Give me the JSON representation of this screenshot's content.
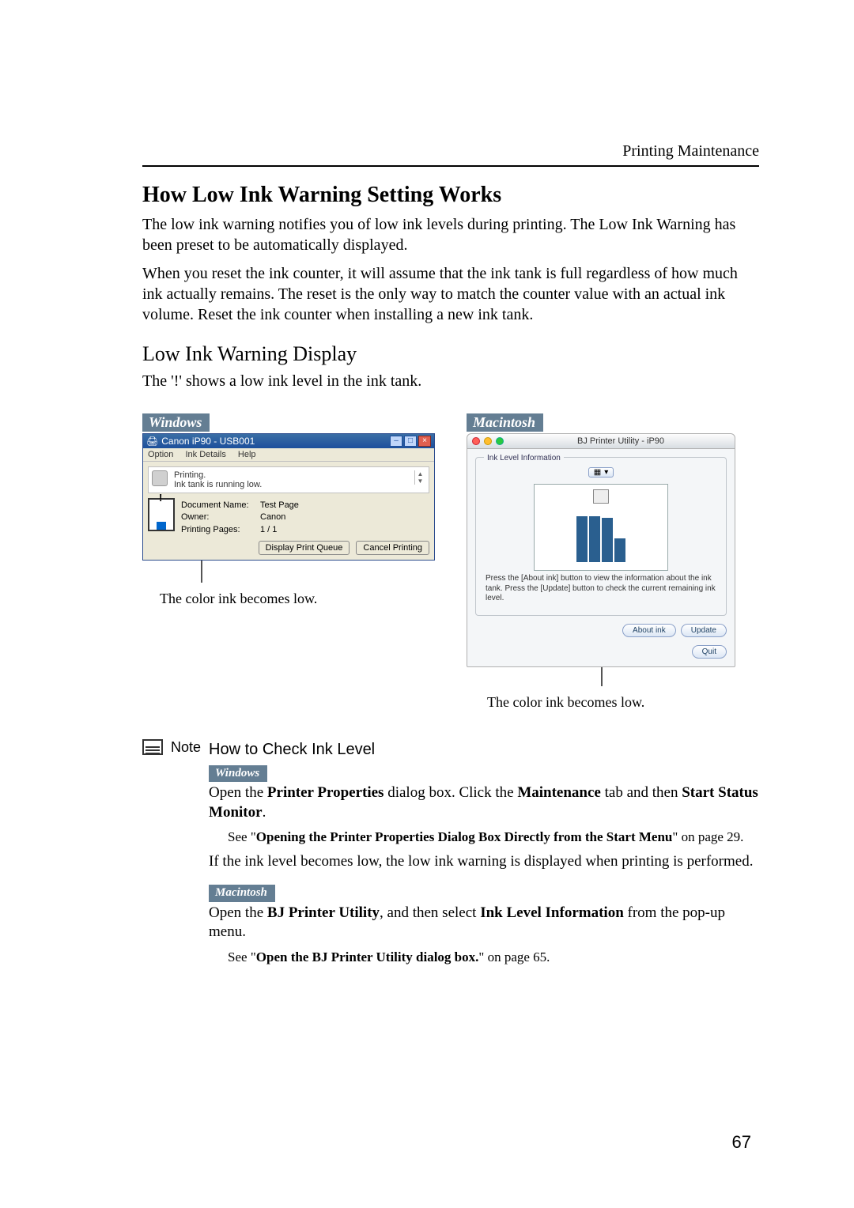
{
  "header": {
    "section_label": "Printing Maintenance"
  },
  "section": {
    "h1": "How Low Ink Warning Setting Works",
    "p1": "The low ink warning notifies you of low ink levels during printing. The Low Ink Warning has been preset to be automatically displayed.",
    "p2": "When you reset the ink counter, it will assume that the ink tank is full regardless of how much ink actually remains. The reset is the only way to match the counter value with an actual ink volume. Reset the ink counter when installing a new ink tank.",
    "h2": "Low Ink Warning Display",
    "p3": "The '!' shows a low ink level in the ink tank."
  },
  "os_labels": {
    "windows": "Windows",
    "macintosh": "Macintosh"
  },
  "win": {
    "title": "Canon iP90 - USB001",
    "menu_option": "Option",
    "menu_inkdetails": "Ink Details",
    "menu_help": "Help",
    "status_line1": "Printing.",
    "status_line2": "Ink tank is running low.",
    "field_doc_label": "Document Name:",
    "field_doc_val": "Test Page",
    "field_owner_label": "Owner:",
    "field_owner_val": "Canon",
    "field_pages_label": "Printing Pages:",
    "field_pages_val": "1 / 1",
    "btn_queue": "Display Print Queue",
    "btn_cancel": "Cancel Printing",
    "caption": "The color ink becomes low."
  },
  "mac": {
    "title": "BJ Printer Utility - iP90",
    "panel_label": "Ink Level Information",
    "msg": "Press the [About ink] button to view the information about the ink tank. Press the [Update] button to check the current remaining ink level.",
    "btn_about": "About ink",
    "btn_update": "Update",
    "btn_quit": "Quit",
    "caption": "The color ink becomes low."
  },
  "note": {
    "label": "Note",
    "heading": "How to Check Ink Level",
    "win_p_pre": "Open the ",
    "win_p_b1": "Printer Properties",
    "win_p_mid": " dialog box. Click the ",
    "win_p_b2": "Maintenance",
    "win_p_mid2": " tab and then ",
    "win_p_b3": "Start Status Monitor",
    "win_p_end": ".",
    "win_sub_pre": "See \"",
    "win_sub_b": "Opening the Printer Properties Dialog Box Directly from the Start Menu",
    "win_sub_post": "\" on page 29.",
    "win_p2": "If the ink level becomes low, the low ink warning is displayed when printing is performed.",
    "mac_p_pre": "Open the ",
    "mac_p_b1": "BJ Printer Utility",
    "mac_p_mid": ", and then select ",
    "mac_p_b2": "Ink Level Information",
    "mac_p_end": " from the pop-up menu.",
    "mac_sub_pre": "See \"",
    "mac_sub_b": "Open the BJ Printer Utility dialog box.",
    "mac_sub_post": "\" on page 65."
  },
  "page_number": "67"
}
